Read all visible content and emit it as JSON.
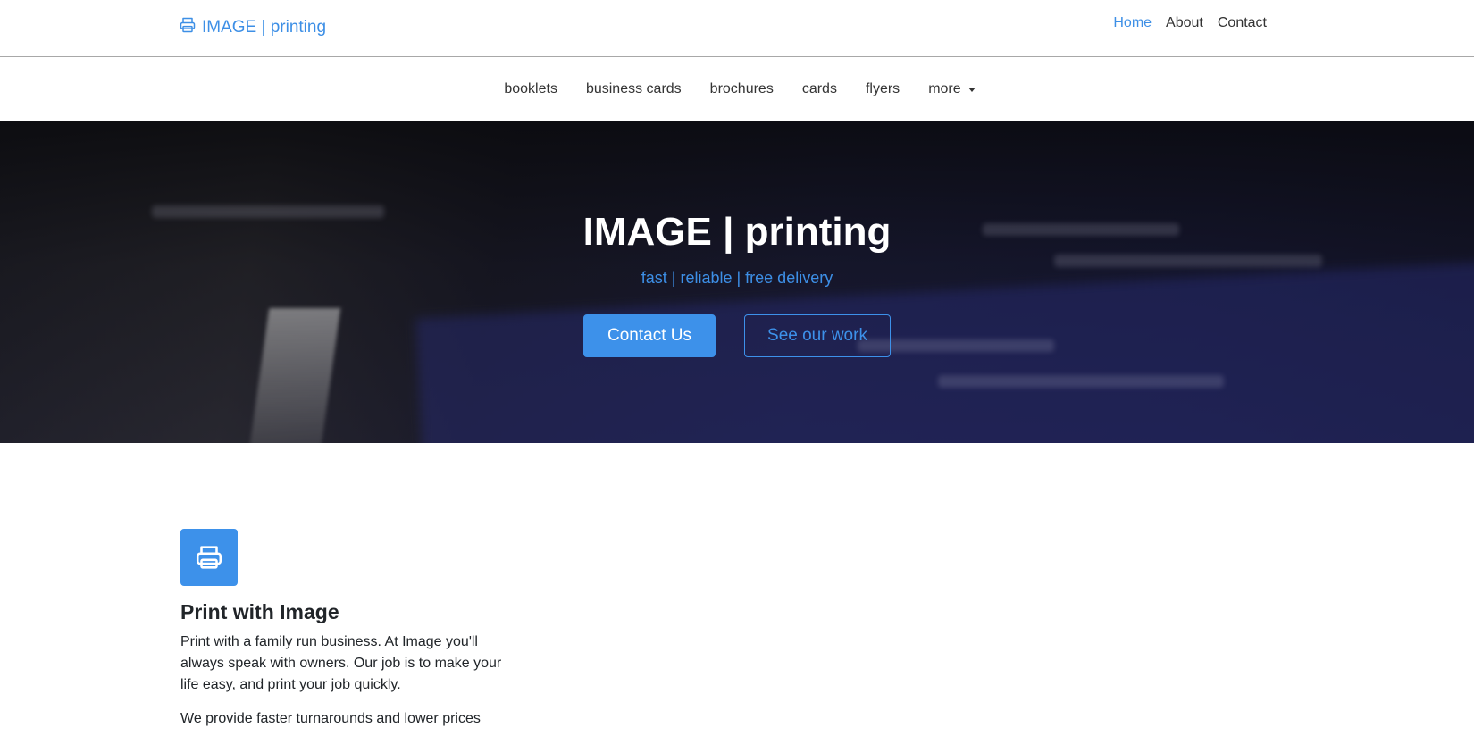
{
  "brand": {
    "icon": "printer-icon",
    "name": "IMAGE | printing",
    "color": "#3d8fe6"
  },
  "topnav": {
    "items": [
      {
        "label": "Home",
        "active": true
      },
      {
        "label": "About",
        "active": false
      },
      {
        "label": "Contact",
        "active": false
      }
    ]
  },
  "catnav": {
    "items": [
      "booklets",
      "business cards",
      "brochures",
      "cards",
      "flyers"
    ],
    "more_label": "more"
  },
  "hero": {
    "title": "IMAGE | printing",
    "subtitle": "fast | reliable | free delivery",
    "primary_button": "Contact Us",
    "secondary_button": "See our work"
  },
  "feature": {
    "icon": "printer-icon",
    "title": "Print with Image",
    "text": "Print with a family run business. At Image you'll always speak with owners. Our job is to make your life easy, and print your job quickly.",
    "text2": "We provide faster turnarounds and lower prices"
  },
  "colors": {
    "accent": "#3d91ea"
  }
}
